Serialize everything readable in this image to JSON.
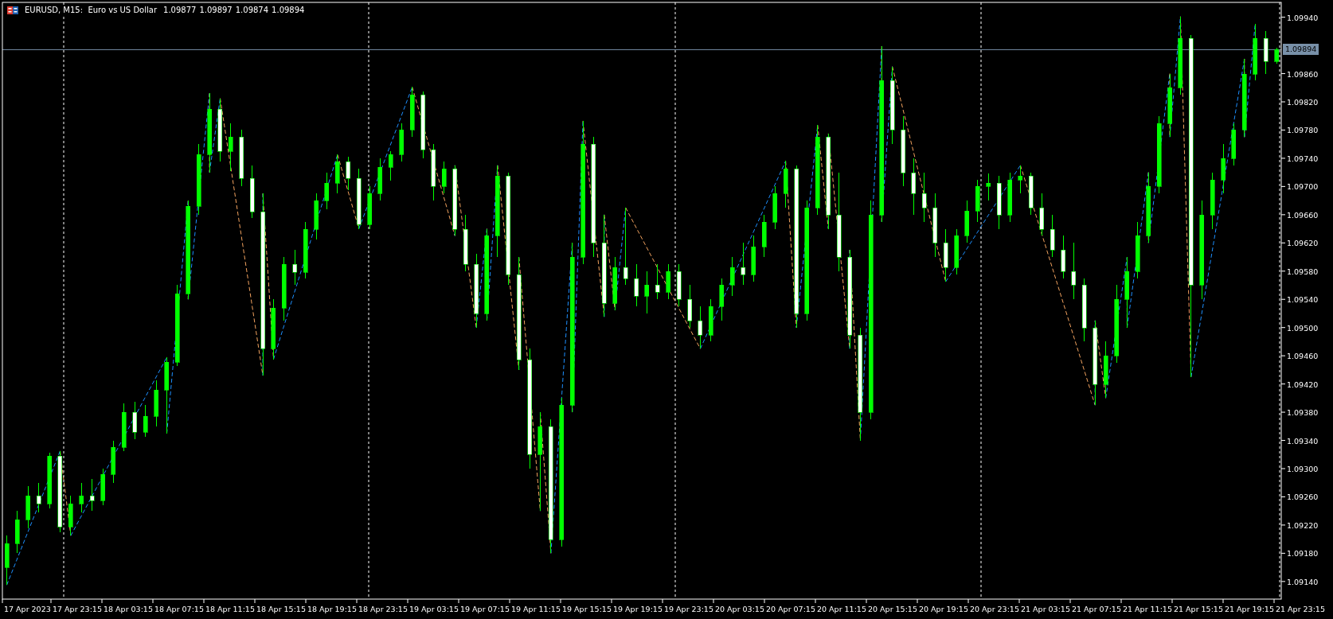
{
  "header": {
    "title": "EURUSD, M15:  Euro vs US Dollar",
    "prices": [
      "1.09877",
      "1.09897",
      "1.09874",
      "1.09894"
    ]
  },
  "current_price": "1.09894",
  "chart_data": {
    "type": "candlestick",
    "ylim": [
      1.09115,
      1.09961
    ],
    "yticks": [
      {
        "value": 1.0994,
        "label": "1.09940"
      },
      {
        "value": 1.0986,
        "label": "1.09860"
      },
      {
        "value": 1.0982,
        "label": "1.09820"
      },
      {
        "value": 1.0978,
        "label": "1.09780"
      },
      {
        "value": 1.0974,
        "label": "1.09740"
      },
      {
        "value": 1.097,
        "label": "1.09700"
      },
      {
        "value": 1.0966,
        "label": "1.09660"
      },
      {
        "value": 1.0962,
        "label": "1.09620"
      },
      {
        "value": 1.0958,
        "label": "1.09580"
      },
      {
        "value": 1.0954,
        "label": "1.09540"
      },
      {
        "value": 1.095,
        "label": "1.09500"
      },
      {
        "value": 1.0946,
        "label": "1.09460"
      },
      {
        "value": 1.0942,
        "label": "1.09420"
      },
      {
        "value": 1.0938,
        "label": "1.09380"
      },
      {
        "value": 1.0934,
        "label": "1.09340"
      },
      {
        "value": 1.093,
        "label": "1.09300"
      },
      {
        "value": 1.0926,
        "label": "1.09260"
      },
      {
        "value": 1.0922,
        "label": "1.09220"
      },
      {
        "value": 1.0918,
        "label": "1.09180"
      },
      {
        "value": 1.0914,
        "label": "1.09140"
      }
    ],
    "ohlc": [
      [
        1.0916,
        1.09205,
        1.09135,
        1.09194
      ],
      [
        1.09194,
        1.0924,
        1.0918,
        1.09228
      ],
      [
        1.09228,
        1.09275,
        1.09215,
        1.09262
      ],
      [
        1.09262,
        1.0928,
        1.09238,
        1.0925
      ],
      [
        1.0925,
        1.09322,
        1.09244,
        1.09318
      ],
      [
        1.09318,
        1.09325,
        1.0921,
        1.09218
      ],
      [
        1.09218,
        1.09262,
        1.09205,
        1.0925
      ],
      [
        1.0925,
        1.0928,
        1.09238,
        1.09262
      ],
      [
        1.09262,
        1.09285,
        1.0924,
        1.09255
      ],
      [
        1.09255,
        1.093,
        1.09248,
        1.09292
      ],
      [
        1.09292,
        1.0934,
        1.0928,
        1.0933
      ],
      [
        1.0933,
        1.09392,
        1.09325,
        1.0938
      ],
      [
        1.0938,
        1.09395,
        1.09342,
        1.09352
      ],
      [
        1.09352,
        1.0939,
        1.09345,
        1.09375
      ],
      [
        1.09375,
        1.09425,
        1.0936,
        1.09412
      ],
      [
        1.09412,
        1.09458,
        1.0935,
        1.09451
      ],
      [
        1.09451,
        1.0956,
        1.09445,
        1.09548
      ],
      [
        1.09548,
        1.0968,
        1.0954,
        1.09672
      ],
      [
        1.09672,
        1.0976,
        1.0966,
        1.09745
      ],
      [
        1.09745,
        1.09832,
        1.0972,
        1.0981
      ],
      [
        1.0981,
        1.09825,
        1.09735,
        1.0975
      ],
      [
        1.0975,
        1.0979,
        1.09722,
        1.0977
      ],
      [
        1.0977,
        1.0978,
        1.097,
        1.09712
      ],
      [
        1.09712,
        1.0973,
        1.09655,
        1.09664
      ],
      [
        1.09664,
        1.0969,
        1.09432,
        1.0947
      ],
      [
        1.0947,
        1.0954,
        1.09455,
        1.09528
      ],
      [
        1.09528,
        1.096,
        1.0951,
        1.0959
      ],
      [
        1.0959,
        1.0961,
        1.0956,
        1.09579
      ],
      [
        1.09579,
        1.0965,
        1.0957,
        1.0964
      ],
      [
        1.0964,
        1.0969,
        1.09625,
        1.0968
      ],
      [
        1.0968,
        1.0972,
        1.09668,
        1.09705
      ],
      [
        1.09705,
        1.09745,
        1.0969,
        1.09735
      ],
      [
        1.09735,
        1.09742,
        1.09695,
        1.09712
      ],
      [
        1.09712,
        1.09725,
        1.0964,
        1.09646
      ],
      [
        1.09646,
        1.097,
        1.0964,
        1.0969
      ],
      [
        1.0969,
        1.0974,
        1.0968,
        1.09728
      ],
      [
        1.09728,
        1.0975,
        1.09708,
        1.09745
      ],
      [
        1.09745,
        1.0979,
        1.09735,
        1.0978
      ],
      [
        1.0978,
        1.09841,
        1.0977,
        1.0983
      ],
      [
        1.0983,
        1.09835,
        1.0974,
        1.09752
      ],
      [
        1.09752,
        1.0976,
        1.0968,
        1.097
      ],
      [
        1.097,
        1.09735,
        1.0969,
        1.09725
      ],
      [
        1.09725,
        1.0973,
        1.0963,
        1.0964
      ],
      [
        1.0964,
        1.0966,
        1.0958,
        1.0959
      ],
      [
        1.0959,
        1.09605,
        1.095,
        1.0952
      ],
      [
        1.0952,
        1.0964,
        1.0951,
        1.0963
      ],
      [
        1.0963,
        1.0973,
        1.096,
        1.09715
      ],
      [
        1.09715,
        1.0972,
        1.0956,
        1.09575
      ],
      [
        1.09575,
        1.096,
        1.0944,
        1.09455
      ],
      [
        1.09455,
        1.0947,
        1.093,
        1.0932
      ],
      [
        1.0932,
        1.0938,
        1.0924,
        1.0936
      ],
      [
        1.0936,
        1.0937,
        1.0918,
        1.092
      ],
      [
        1.092,
        1.094,
        1.0919,
        1.0939
      ],
      [
        1.0939,
        1.0962,
        1.0938,
        1.096
      ],
      [
        1.096,
        1.09793,
        1.0959,
        1.0976
      ],
      [
        1.0976,
        1.0977,
        1.096,
        1.0962
      ],
      [
        1.0962,
        1.0966,
        1.09515,
        1.09535
      ],
      [
        1.09535,
        1.096,
        1.09525,
        1.09585
      ],
      [
        1.09585,
        1.0967,
        1.0956,
        1.0957
      ],
      [
        1.0957,
        1.0959,
        1.0953,
        1.09545
      ],
      [
        1.09545,
        1.0958,
        1.0952,
        1.0956
      ],
      [
        1.0956,
        1.0959,
        1.0954,
        1.0955
      ],
      [
        1.0955,
        1.0959,
        1.0954,
        1.0958
      ],
      [
        1.0958,
        1.0959,
        1.0953,
        1.0954
      ],
      [
        1.0954,
        1.0956,
        1.095,
        1.0951
      ],
      [
        1.0951,
        1.0953,
        1.0947,
        1.0949
      ],
      [
        1.0949,
        1.0954,
        1.0948,
        1.0953
      ],
      [
        1.0953,
        1.0957,
        1.0951,
        1.0956
      ],
      [
        1.0956,
        1.096,
        1.09545,
        1.09585
      ],
      [
        1.09585,
        1.0962,
        1.0956,
        1.09575
      ],
      [
        1.09575,
        1.0963,
        1.09565,
        1.09615
      ],
      [
        1.09615,
        1.0966,
        1.096,
        1.0965
      ],
      [
        1.0965,
        1.097,
        1.0964,
        1.0969
      ],
      [
        1.0969,
        1.09736,
        1.0967,
        1.09725
      ],
      [
        1.09725,
        1.0973,
        1.095,
        1.0952
      ],
      [
        1.0952,
        1.0968,
        1.0951,
        1.0967
      ],
      [
        1.0967,
        1.09787,
        1.0966,
        1.0977
      ],
      [
        1.0977,
        1.09775,
        1.0964,
        1.0966
      ],
      [
        1.0966,
        1.0972,
        1.0958,
        1.096
      ],
      [
        1.096,
        1.0961,
        1.0947,
        1.0949
      ],
      [
        1.0949,
        1.095,
        1.0934,
        1.0938
      ],
      [
        1.0938,
        1.0968,
        1.0937,
        1.0966
      ],
      [
        1.0966,
        1.09899,
        1.0965,
        1.0985
      ],
      [
        1.0985,
        1.0987,
        1.0976,
        1.0978
      ],
      [
        1.0978,
        1.098,
        1.097,
        1.0972
      ],
      [
        1.0972,
        1.0974,
        1.0966,
        1.0969
      ],
      [
        1.0969,
        1.0972,
        1.0965,
        1.0967
      ],
      [
        1.0967,
        1.0969,
        1.096,
        1.0962
      ],
      [
        1.0962,
        1.0964,
        1.09565,
        1.09585
      ],
      [
        1.09585,
        1.0964,
        1.09575,
        1.0963
      ],
      [
        1.0963,
        1.0968,
        1.0962,
        1.09665
      ],
      [
        1.09665,
        1.0971,
        1.0965,
        1.097
      ],
      [
        1.097,
        1.09718,
        1.0968,
        1.09705
      ],
      [
        1.09705,
        1.09715,
        1.0964,
        1.0966
      ],
      [
        1.0966,
        1.0972,
        1.0965,
        1.0971
      ],
      [
        1.0971,
        1.0973,
        1.0969,
        1.09715
      ],
      [
        1.09715,
        1.0972,
        1.0966,
        1.0967
      ],
      [
        1.0967,
        1.0969,
        1.0963,
        1.0964
      ],
      [
        1.0964,
        1.0966,
        1.096,
        1.0961
      ],
      [
        1.0961,
        1.0963,
        1.0957,
        1.0958
      ],
      [
        1.0958,
        1.0962,
        1.0954,
        1.0956
      ],
      [
        1.0956,
        1.0957,
        1.0948,
        1.095
      ],
      [
        1.095,
        1.0951,
        1.0939,
        1.0942
      ],
      [
        1.0942,
        1.0948,
        1.094,
        1.0946
      ],
      [
        1.0946,
        1.0956,
        1.0945,
        1.0954
      ],
      [
        1.0954,
        1.096,
        1.095,
        1.0958
      ],
      [
        1.0958,
        1.0965,
        1.0957,
        1.0963
      ],
      [
        1.0963,
        1.0972,
        1.0962,
        1.097
      ],
      [
        1.097,
        1.098,
        1.0969,
        1.0979
      ],
      [
        1.0979,
        1.0986,
        1.0977,
        1.0984
      ],
      [
        1.0984,
        1.09941,
        1.0983,
        1.0991
      ],
      [
        1.0991,
        1.09915,
        1.0943,
        1.0956
      ],
      [
        1.0956,
        1.0968,
        1.0954,
        1.0966
      ],
      [
        1.0966,
        1.0972,
        1.0964,
        1.0971
      ],
      [
        1.0971,
        1.0976,
        1.0969,
        1.0974
      ],
      [
        1.0974,
        1.0979,
        1.0973,
        1.0978
      ],
      [
        1.0978,
        1.09881,
        1.0977,
        1.0986
      ],
      [
        1.0986,
        1.0993,
        1.0985,
        1.0991
      ],
      [
        1.0991,
        1.0992,
        1.0986,
        1.09877
      ],
      [
        1.09877,
        1.09897,
        1.09874,
        1.09894
      ]
    ]
  },
  "time_axis": [
    "17 Apr 2023",
    "17 Apr 23:15",
    "18 Apr 03:15",
    "18 Apr 07:15",
    "18 Apr 11:15",
    "18 Apr 15:15",
    "18 Apr 19:15",
    "18 Apr 23:15",
    "19 Apr 03:15",
    "19 Apr 07:15",
    "19 Apr 11:15",
    "19 Apr 15:15",
    "19 Apr 19:15",
    "19 Apr 23:15",
    "20 Apr 03:15",
    "20 Apr 07:15",
    "20 Apr 11:15",
    "20 Apr 15:15",
    "20 Apr 19:15",
    "20 Apr 23:15",
    "21 Apr 03:15",
    "21 Apr 07:15",
    "21 Apr 11:15",
    "21 Apr 15:15",
    "21 Apr 19:15",
    "21 Apr 23:15"
  ]
}
